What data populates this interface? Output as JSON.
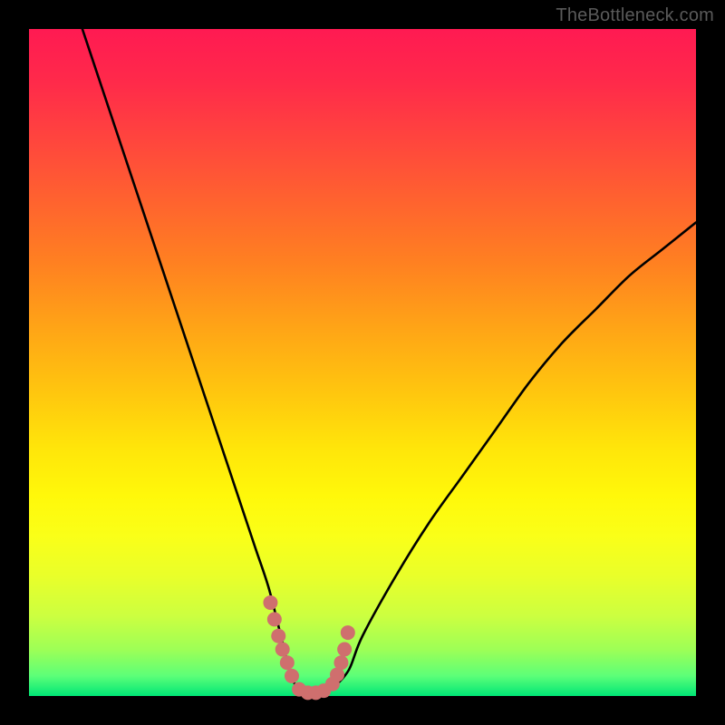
{
  "watermark": "TheBottleneck.com",
  "colors": {
    "page_bg": "#000000",
    "gradient_top": "#ff1a52",
    "gradient_bottom": "#00e676",
    "curve": "#000000",
    "marker": "#cf6f6e"
  },
  "chart_data": {
    "type": "line",
    "title": "",
    "xlabel": "",
    "ylabel": "",
    "xlim": [
      0,
      100
    ],
    "ylim": [
      0,
      100
    ],
    "grid": false,
    "legend": false,
    "series": [
      {
        "name": "bottleneck-curve",
        "x": [
          8,
          10,
          12,
          14,
          16,
          18,
          20,
          22,
          24,
          26,
          28,
          30,
          32,
          34,
          36,
          38,
          39,
          40,
          41,
          42,
          43,
          44,
          45,
          46,
          48,
          50,
          55,
          60,
          65,
          70,
          75,
          80,
          85,
          90,
          95,
          100
        ],
        "y": [
          100,
          94,
          88,
          82,
          76,
          70,
          64,
          58,
          52,
          46,
          40,
          34,
          28,
          22,
          16,
          8,
          4,
          1.5,
          0.6,
          0.3,
          0.3,
          0.4,
          0.8,
          1.6,
          4,
          9,
          18,
          26,
          33,
          40,
          47,
          53,
          58,
          63,
          67,
          71
        ]
      }
    ],
    "markers": {
      "name": "highlight-dots",
      "x": [
        36.2,
        36.8,
        37.4,
        38.0,
        38.7,
        39.4,
        40.5,
        41.8,
        43.0,
        44.2,
        45.5,
        46.2,
        46.8,
        47.3,
        47.8
      ],
      "y": [
        14.0,
        11.5,
        9.0,
        7.0,
        5.0,
        3.0,
        1.0,
        0.5,
        0.5,
        0.8,
        1.8,
        3.2,
        5.0,
        7.0,
        9.5
      ]
    }
  }
}
